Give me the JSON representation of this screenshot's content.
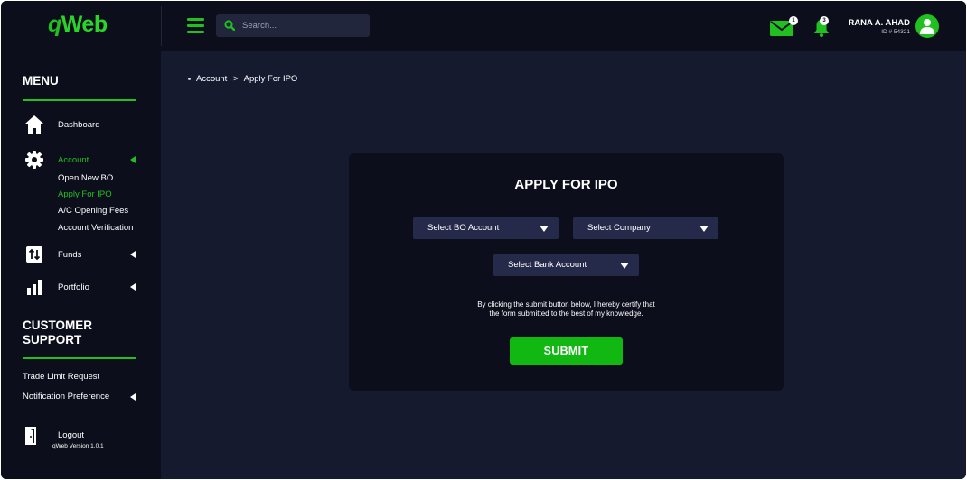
{
  "app": {
    "logo_q": "q",
    "logo_web": "Web",
    "accent_color": "#1fc01f"
  },
  "header": {
    "search_placeholder": "Search...",
    "mail_badge": "1",
    "notification_badge": "3",
    "user_name": "RANA A. AHAD",
    "user_id": "ID # 54321",
    "icons": [
      "menu-icon",
      "search-icon",
      "mail-icon",
      "bell-icon",
      "user-icon"
    ]
  },
  "sidebar": {
    "menu_title": "MENU",
    "items": {
      "dashboard": "Dashboard",
      "account": "Account",
      "funds": "Funds",
      "portfolio": "Portfolio"
    },
    "account_subitems": [
      "Open New BO",
      "Apply For IPO",
      "A/C Opening Fees",
      "Account Verification"
    ],
    "active_subitem": "Apply For IPO",
    "support_title_line1": "CUSTOMER",
    "support_title_line2": "SUPPORT",
    "support_items": {
      "trade_limit": "Trade Limit Request",
      "notification_pref": "Notification Preference"
    },
    "logout": "Logout",
    "version": "qWeb Version 1.0.1"
  },
  "breadcrumb": {
    "parent": "Account",
    "separator": ">",
    "current": "Apply For IPO"
  },
  "form": {
    "title": "APPLY FOR IPO",
    "select_bo": "Select BO Account",
    "select_company": "Select Company",
    "select_bank": "Select Bank Account",
    "notice_line1": "By clicking the submit button below, I hereby certify that",
    "notice_line2": "the form submitted to the best of my knowledge.",
    "submit_label": "SUBMIT"
  }
}
